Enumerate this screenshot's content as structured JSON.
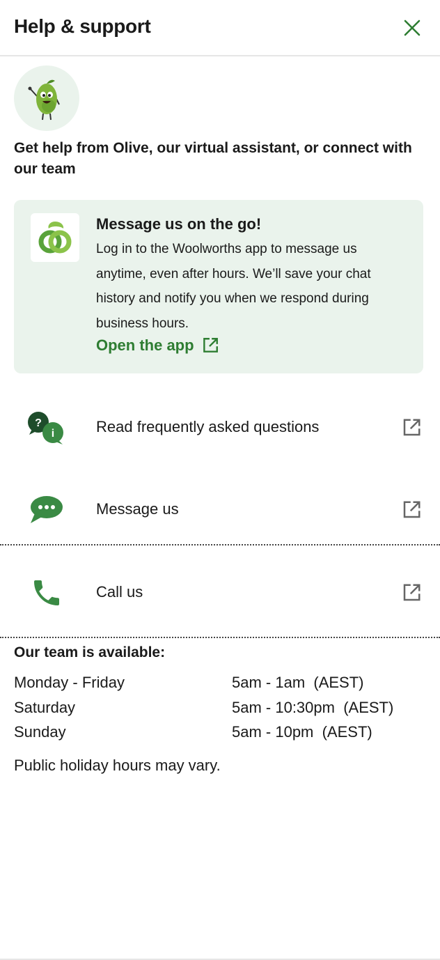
{
  "header": {
    "title": "Help & support",
    "close_icon": "close-icon"
  },
  "intro": {
    "text": "Get help from Olive, our virtual assistant, or connect with our team",
    "avatar_icon": "olive-mascot-icon"
  },
  "promo": {
    "title": "Message us on the go!",
    "body": "Log in to the Woolworths app to message us anytime, even after hours. We’ll save your chat history and notify you when we respond during business hours.",
    "link_label": "Open the app",
    "logo_icon": "woolworths-logo-icon",
    "link_icon": "external-link-icon"
  },
  "options": [
    {
      "label": "Read frequently asked questions",
      "icon": "faq-chat-icon"
    },
    {
      "label": "Message us",
      "icon": "message-bubble-icon"
    },
    {
      "label": "Call us",
      "icon": "phone-icon"
    }
  ],
  "hours": {
    "title": "Our team is available:",
    "rows": [
      {
        "day": "Monday - Friday",
        "time": "5am - 1am  (AEST)"
      },
      {
        "day": "Saturday",
        "time": "5am - 10:30pm  (AEST)"
      },
      {
        "day": "Sunday",
        "time": "5am - 10pm  (AEST)"
      }
    ],
    "note": "Public holiday hours may vary."
  },
  "colors": {
    "brand_green": "#2e7d32",
    "light_green": "#eaf3ec",
    "icon_green": "#3a8a44"
  }
}
